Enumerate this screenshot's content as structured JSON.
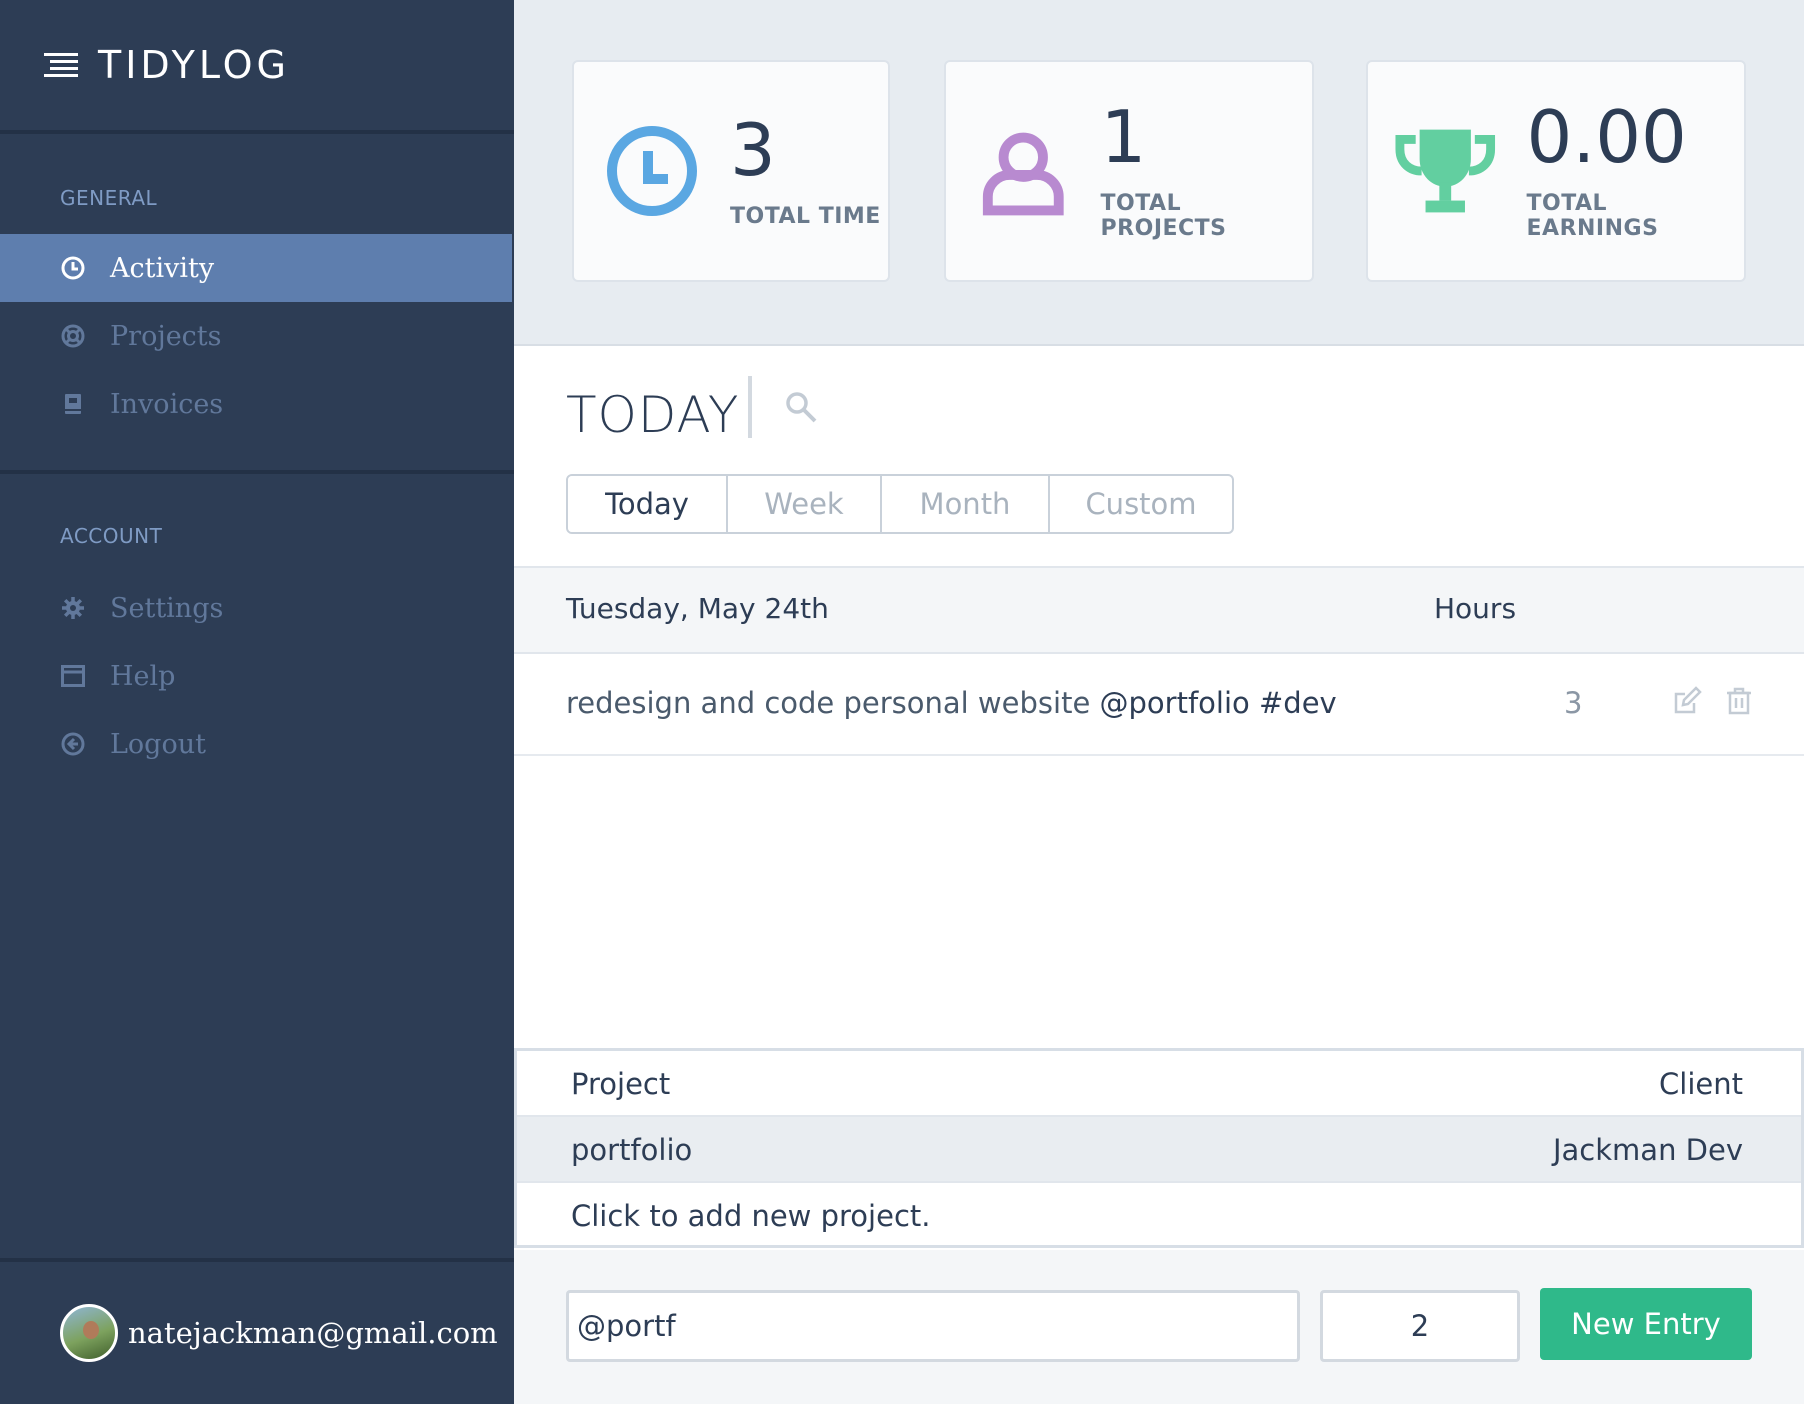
{
  "app": {
    "brand": "TIDYLOG"
  },
  "colors": {
    "sidebar": "#2d3d55",
    "active": "#5e7eae",
    "time_icon": "#5aa7e2",
    "projects_icon": "#b88ad0",
    "earnings_icon": "#62cfa0",
    "primary": "#2fb98a"
  },
  "sidebar": {
    "general_label": "GENERAL",
    "account_label": "ACCOUNT",
    "general_items": [
      {
        "label": "Activity",
        "icon": "clock-icon",
        "active": true
      },
      {
        "label": "Projects",
        "icon": "lifebuoy-icon",
        "active": false
      },
      {
        "label": "Invoices",
        "icon": "book-icon",
        "active": false
      }
    ],
    "account_items": [
      {
        "label": "Settings",
        "icon": "gear-icon"
      },
      {
        "label": "Help",
        "icon": "window-icon"
      },
      {
        "label": "Logout",
        "icon": "back-arrow-icon"
      }
    ],
    "user": {
      "email": "natejackman@gmail.com"
    }
  },
  "stats": [
    {
      "value": "3",
      "label": "TOTAL TIME",
      "icon": "clock-icon"
    },
    {
      "value": "1",
      "label": "TOTAL PROJECTS",
      "icon": "user-icon"
    },
    {
      "value": "0.00",
      "label": "TOTAL EARNINGS",
      "icon": "trophy-icon"
    }
  ],
  "main": {
    "title": "TODAY",
    "tabs": [
      "Today",
      "Week",
      "Month",
      "Custom"
    ],
    "active_tab": "Today",
    "day": {
      "date": "Tuesday, May 24th",
      "hours_header": "Hours"
    },
    "entries": [
      {
        "text": "redesign and code personal website",
        "project": "@portfolio",
        "tag": "#dev",
        "hours": "3"
      }
    ],
    "projects": {
      "headers": {
        "project": "Project",
        "client": "Client"
      },
      "rows": [
        {
          "project": "portfolio",
          "client": "Jackman Dev"
        }
      ],
      "add_label": "Click to add new project."
    },
    "new_entry": {
      "text_value": "@portf",
      "hours_value": "2",
      "button": "New Entry"
    }
  }
}
